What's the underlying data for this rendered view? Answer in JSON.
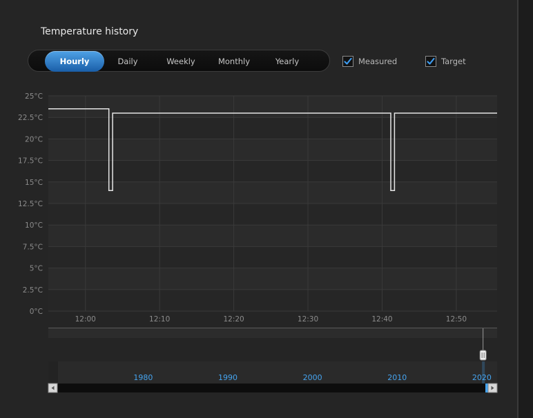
{
  "title": "Temperature history",
  "tabs": [
    {
      "label": "Hourly",
      "active": true
    },
    {
      "label": "Daily",
      "active": false
    },
    {
      "label": "Weekly",
      "active": false
    },
    {
      "label": "Monthly",
      "active": false
    },
    {
      "label": "Yearly",
      "active": false
    }
  ],
  "toggles": {
    "measured": {
      "label": "Measured",
      "checked": true
    },
    "target": {
      "label": "Target",
      "checked": true
    }
  },
  "colors": {
    "accent": "#1a6fc4",
    "check": "#3d9cf0",
    "series_line": "#e6e6e6",
    "navigator_label": "#45a4f0"
  },
  "chart_data": {
    "type": "line",
    "title": "",
    "xlabel": "",
    "ylabel": "",
    "ylim": [
      0,
      25
    ],
    "y_ticks": [
      "0°C",
      "2.5°C",
      "5°C",
      "7.5°C",
      "10°C",
      "12.5°C",
      "15°C",
      "17.5°C",
      "20°C",
      "22.5°C",
      "25°C"
    ],
    "y_tick_values": [
      0,
      2.5,
      5,
      7.5,
      10,
      12.5,
      15,
      17.5,
      20,
      22.5,
      25
    ],
    "xlim": [
      "11:55",
      "12:55:30"
    ],
    "x_ticks": [
      "12:00",
      "12:10",
      "12:20",
      "12:30",
      "12:40",
      "12:50"
    ],
    "grid": true,
    "series": [
      {
        "x": [
          "11:55",
          "12:03:10",
          "12:03:10",
          "12:03:40",
          "12:03:40",
          "12:41:10",
          "12:41:10",
          "12:41:40",
          "12:41:40",
          "12:55:30"
        ],
        "values": [
          23.5,
          23.5,
          14,
          14,
          23,
          23,
          14,
          14,
          23,
          23
        ]
      }
    ],
    "navigator": {
      "x_ticks": [
        "1980",
        "1990",
        "2000",
        "2010",
        "2020"
      ],
      "x_tick_values": [
        1980,
        1990,
        2000,
        2010,
        2020
      ],
      "xlim": [
        1968.8,
        2021.8
      ],
      "selection": [
        2020.1,
        2020.2
      ]
    }
  }
}
